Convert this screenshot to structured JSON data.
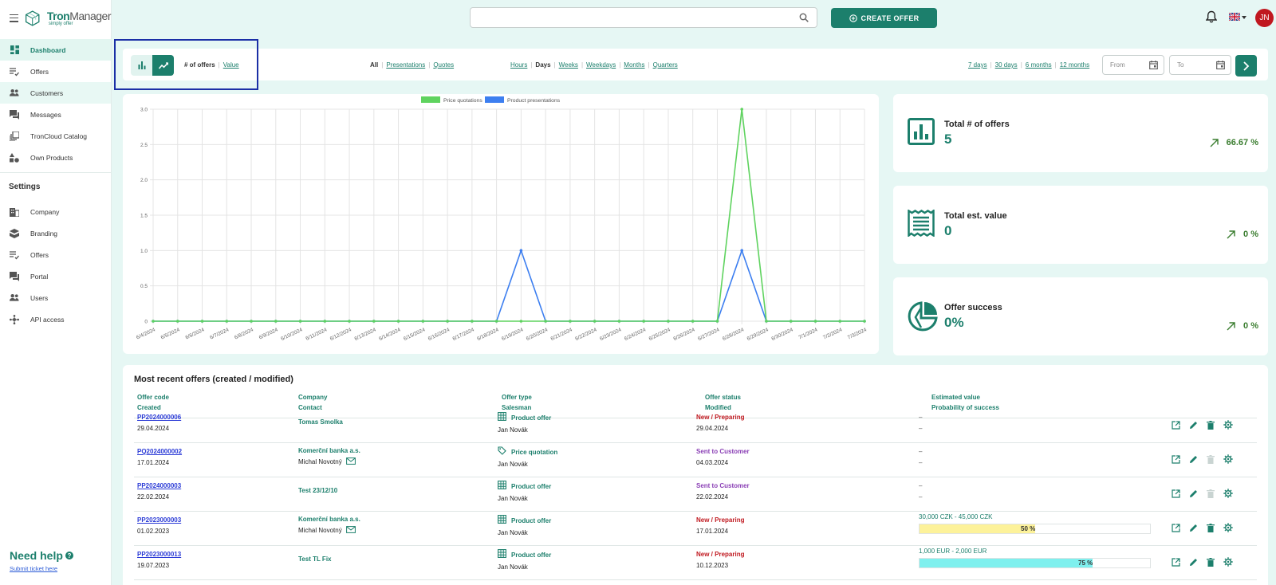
{
  "app": {
    "name_a": "Tron",
    "name_b": "Manager",
    "tagline": "simply offer"
  },
  "sidebar": {
    "items": [
      {
        "label": "Dashboard",
        "icon": "dashboard-icon"
      },
      {
        "label": "Offers",
        "icon": "offers-list-icon"
      },
      {
        "label": "Customers",
        "icon": "customers-icon"
      },
      {
        "label": "Messages",
        "icon": "messages-icon"
      },
      {
        "label": "TronCloud Catalog",
        "icon": "catalog-icon"
      },
      {
        "label": "Own Products",
        "icon": "products-icon"
      }
    ],
    "settings_title": "Settings",
    "settings_items": [
      {
        "label": "Company",
        "icon": "company-icon"
      },
      {
        "label": "Branding",
        "icon": "branding-icon"
      },
      {
        "label": "Offers",
        "icon": "offers-settings-icon"
      },
      {
        "label": "Portal",
        "icon": "portal-icon"
      },
      {
        "label": "Users",
        "icon": "users-icon"
      },
      {
        "label": "API access",
        "icon": "api-icon"
      }
    ],
    "help_title": "Need help",
    "help_link": "Submit ticket here"
  },
  "header": {
    "create_offer": "CREATE OFFER",
    "avatar_initials": "JN"
  },
  "filters": {
    "metric": {
      "count": "# of offers",
      "value": "Value"
    },
    "types": {
      "all": "All",
      "presentations": "Presentations",
      "quotes": "Quotes"
    },
    "periods": {
      "hours": "Hours",
      "days": "Days",
      "weeks": "Weeks",
      "weekdays": "Weekdays",
      "months": "Months",
      "quarters": "Quarters"
    },
    "ranges": {
      "d7": "7 days",
      "d30": "30 days",
      "m6": "6 months",
      "m12": "12 months"
    },
    "from_placeholder": "From",
    "to_placeholder": "To"
  },
  "chart_data": {
    "type": "line",
    "x": [
      "6/4/2024",
      "6/5/2024",
      "6/6/2024",
      "6/7/2024",
      "6/8/2024",
      "6/9/2024",
      "6/10/2024",
      "6/11/2024",
      "6/12/2024",
      "6/13/2024",
      "6/14/2024",
      "6/15/2024",
      "6/16/2024",
      "6/17/2024",
      "6/18/2024",
      "6/19/2024",
      "6/20/2024",
      "6/21/2024",
      "6/22/2024",
      "6/23/2024",
      "6/24/2024",
      "6/25/2024",
      "6/26/2024",
      "6/27/2024",
      "6/28/2024",
      "6/29/2024",
      "6/30/2024",
      "7/1/2024",
      "7/2/2024",
      "7/3/2024"
    ],
    "series": [
      {
        "name": "Price quotations",
        "color": "#5fd35f",
        "values": [
          0,
          0,
          0,
          0,
          0,
          0,
          0,
          0,
          0,
          0,
          0,
          0,
          0,
          0,
          0,
          0,
          0,
          0,
          0,
          0,
          0,
          0,
          0,
          0,
          3,
          0,
          0,
          0,
          0,
          0
        ]
      },
      {
        "name": "Product presentations",
        "color": "#3d7ff0",
        "values": [
          0,
          0,
          0,
          0,
          0,
          0,
          0,
          0,
          0,
          0,
          0,
          0,
          0,
          0,
          0,
          1,
          0,
          0,
          0,
          0,
          0,
          0,
          0,
          0,
          1,
          0,
          0,
          0,
          0,
          0
        ]
      }
    ],
    "yticks": [
      "0",
      "0.5",
      "1.0",
      "1.5",
      "2.0",
      "2.5",
      "3.0"
    ],
    "ylim": [
      0,
      3
    ],
    "grid": true,
    "legend": "top-center"
  },
  "stats": [
    {
      "title": "Total # of offers",
      "value": "5",
      "trend": "66.67 %",
      "icon": "chart-stat-icon"
    },
    {
      "title": "Total est. value",
      "value": "0",
      "trend": "0 %",
      "icon": "receipt-icon"
    },
    {
      "title": "Offer success",
      "value": "0%",
      "trend": "0 %",
      "icon": "pie-icon"
    }
  ],
  "table": {
    "title": "Most recent offers (created / modified)",
    "headers": {
      "code": "Offer code",
      "created": "Created",
      "company": "Company",
      "contact": "Contact",
      "type": "Offer type",
      "salesman": "Salesman",
      "status": "Offer status",
      "modified": "Modified",
      "est": "Estimated value",
      "prob": "Probability of success"
    },
    "rows": [
      {
        "code": "PP2024000006",
        "created": "29.04.2024",
        "company": "Tomas Smolka",
        "contact": "",
        "type": "Product offer",
        "type_icon": "grid-icon",
        "salesman": "Jan Novák",
        "status": "New / Preparing",
        "status_kind": "new",
        "modified": "29.04.2024",
        "est": "–",
        "prob": "–",
        "prob_value": null
      },
      {
        "code": "PQ2024000002",
        "created": "17.01.2024",
        "company": "Komerční banka a.s.",
        "contact": "Michal Novotný",
        "type": "Price quotation",
        "type_icon": "tag-icon",
        "salesman": "Jan Novák",
        "status": "Sent to Customer",
        "status_kind": "sent",
        "modified": "04.03.2024",
        "est": "–",
        "prob": "–",
        "prob_value": null
      },
      {
        "code": "PP2024000003",
        "created": "22.02.2024",
        "company": "Test 23/12/10",
        "contact": "",
        "type": "Product offer",
        "type_icon": "grid-icon",
        "salesman": "Jan Novák",
        "status": "Sent to Customer",
        "status_kind": "sent",
        "modified": "22.02.2024",
        "est": "–",
        "prob": "–",
        "prob_value": null
      },
      {
        "code": "PP2023000003",
        "created": "01.02.2023",
        "company": "Komerční banka a.s.",
        "contact": "Michal Novotný",
        "type": "Product offer",
        "type_icon": "grid-icon",
        "salesman": "Jan Novák",
        "status": "New / Preparing",
        "status_kind": "new",
        "modified": "17.01.2024",
        "est": "30,000 CZK - 45,000 CZK",
        "prob": "50 %",
        "prob_value": 0.5,
        "bar_color": "#fdf29a"
      },
      {
        "code": "PP2023000013",
        "created": "19.07.2023",
        "company": "Test TL Fix",
        "contact": "",
        "type": "Product offer",
        "type_icon": "grid-icon",
        "salesman": "Jan Novák",
        "status": "New / Preparing",
        "status_kind": "new",
        "modified": "10.12.2023",
        "est": "1,000 EUR - 2,000 EUR",
        "prob": "75 %",
        "prob_value": 0.75,
        "bar_color": "#7ff0ee"
      }
    ]
  }
}
